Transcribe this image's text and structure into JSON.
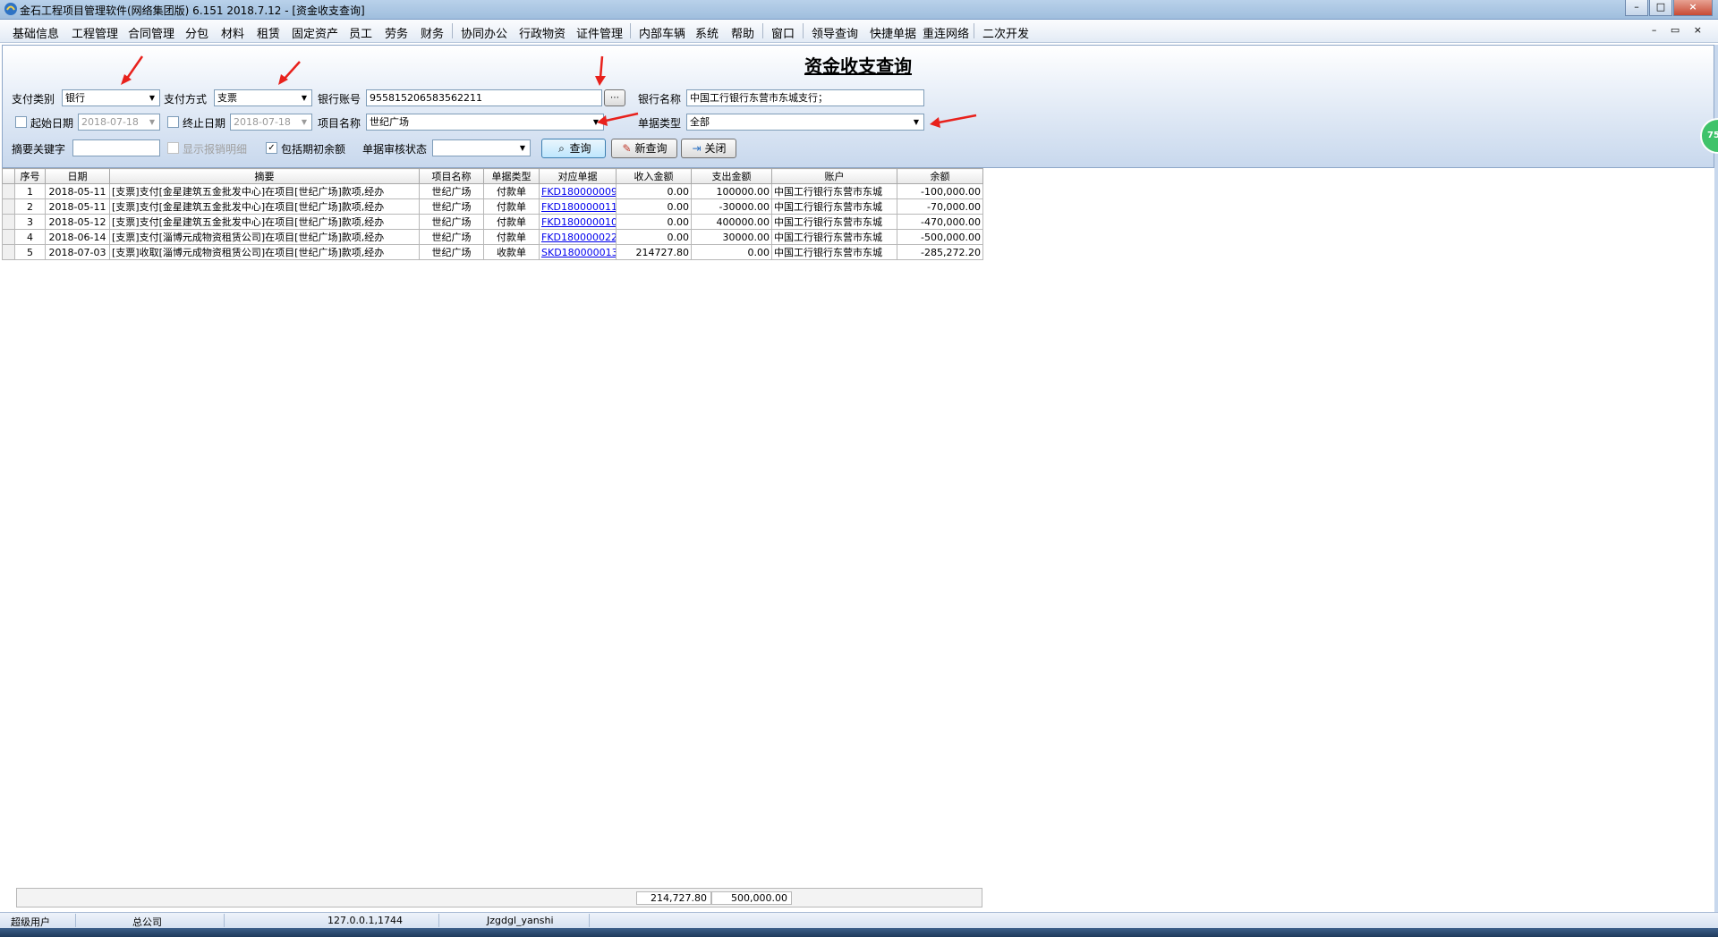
{
  "window": {
    "title": "金石工程项目管理软件(网络集团版) 6.151  2018.7.12 - [资金收支查询]",
    "minimize": "–",
    "maximize": "□",
    "close": "×"
  },
  "menu": {
    "items": [
      "基础信息",
      "工程管理",
      "合同管理",
      "分包",
      "材料",
      "租赁",
      "固定资产",
      "员工",
      "劳务",
      "财务",
      "协同办公",
      "行政物资",
      "证件管理",
      "内部车辆",
      "系统",
      "帮助",
      "窗口",
      "领导查询",
      "快捷单据",
      "重连网络",
      "二次开发"
    ],
    "mdi_buttons": "– ▭ ×"
  },
  "page": {
    "title": "资金收支查询"
  },
  "form": {
    "pay_category_label": "支付类别",
    "pay_category_value": "银行",
    "pay_method_label": "支付方式",
    "pay_method_value": "支票",
    "bank_account_label": "银行账号",
    "bank_account_value": "955815206583562211",
    "bank_name_label": "银行名称",
    "bank_name_value": "中国工行银行东营市东城支行；",
    "start_date_label": "起始日期",
    "start_date_value": "2018-07-18",
    "start_date_checked": false,
    "end_date_label": "终止日期",
    "end_date_value": "2018-07-18",
    "end_date_checked": false,
    "project_label": "项目名称",
    "project_value": "世纪广场",
    "doc_type_label": "单据类型",
    "doc_type_value": "全部",
    "keyword_label": "摘要关键字",
    "keyword_value": "",
    "show_detail_label": "显示报销明细",
    "show_detail_checked": false,
    "include_opening_label": "包括期初余额",
    "include_opening_checked": true,
    "audit_status_label": "单据审核状态",
    "audit_status_value": "",
    "query_button": "查询",
    "new_query_button": "新查询",
    "close_button": "关闭"
  },
  "grid": {
    "columns": [
      "序号",
      "日期",
      "摘要",
      "项目名称",
      "单据类型",
      "对应单据",
      "收入金额",
      "支出金额",
      "账户",
      "余额"
    ],
    "rows": [
      [
        "1",
        "2018-05-11",
        "[支票]支付[金星建筑五金批发中心]在项目[世纪广场]款项,经办",
        "世纪广场",
        "付款单",
        "FKD180000009",
        "0.00",
        "100000.00",
        "中国工行银行东营市东城",
        "-100,000.00"
      ],
      [
        "2",
        "2018-05-11",
        "[支票]支付[金星建筑五金批发中心]在项目[世纪广场]款项,经办",
        "世纪广场",
        "付款单",
        "FKD180000011",
        "0.00",
        "-30000.00",
        "中国工行银行东营市东城",
        "-70,000.00"
      ],
      [
        "3",
        "2018-05-12",
        "[支票]支付[金星建筑五金批发中心]在项目[世纪广场]款项,经办",
        "世纪广场",
        "付款单",
        "FKD180000010",
        "0.00",
        "400000.00",
        "中国工行银行东营市东城",
        "-470,000.00"
      ],
      [
        "4",
        "2018-06-14",
        "[支票]支付[淄博元成物资租赁公司]在项目[世纪广场]款项,经办",
        "世纪广场",
        "付款单",
        "FKD180000022",
        "0.00",
        "30000.00",
        "中国工行银行东营市东城",
        "-500,000.00"
      ],
      [
        "5",
        "2018-07-03",
        "[支票]收取[淄博元成物资租赁公司]在项目[世纪广场]款项,经办",
        "世纪广场",
        "收款单",
        "SKD180000013",
        "214727.80",
        "0.00",
        "中国工行银行东营市东城",
        "-285,272.20"
      ]
    ]
  },
  "totals": {
    "income": "214,727.80",
    "expense": "500,000.00"
  },
  "status": {
    "user": "超级用户",
    "company": "总公司",
    "address": "127.0.0.1,1744",
    "database": "Jzgdgl_yanshi"
  },
  "badge": {
    "text": "75"
  },
  "colors": {
    "annotation_arrow": "#e8211c",
    "accent": "#3c7fb1"
  }
}
